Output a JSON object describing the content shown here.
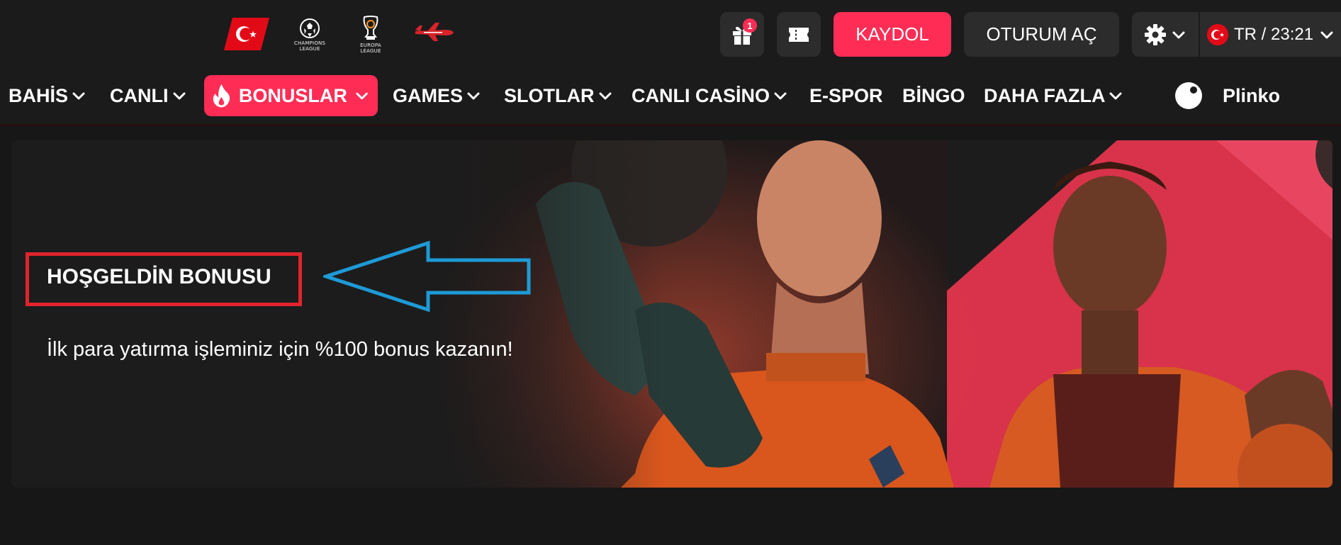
{
  "header": {
    "logos": [
      {
        "name": "turkey-flag-logo",
        "caption": ""
      },
      {
        "name": "champions-league-logo",
        "caption": "CHAMPIONS\nLEAGUE"
      },
      {
        "name": "europa-league-logo",
        "caption": "EUROPA\nLEAGUE"
      },
      {
        "name": "aviator-plane-logo",
        "caption": ""
      }
    ],
    "gift_badge": "1",
    "register_label": "KAYDOL",
    "login_label": "OTURUM AÇ",
    "language_time": "TR / 23:21"
  },
  "nav": {
    "items": [
      {
        "label": "BAHİS",
        "has_dropdown": true
      },
      {
        "label": "CANLI",
        "has_dropdown": true
      },
      {
        "label": "BONUSLAR",
        "has_dropdown": true,
        "active": true
      },
      {
        "label": "GAMES",
        "has_dropdown": true
      },
      {
        "label": "SLOTLAR",
        "has_dropdown": true
      },
      {
        "label": "CANLI CASİNO",
        "has_dropdown": true
      },
      {
        "label": "E-SPOR",
        "has_dropdown": false
      },
      {
        "label": "BİNGO",
        "has_dropdown": false
      },
      {
        "label": "DAHA FAZLA",
        "has_dropdown": true
      },
      {
        "label": "Plinko",
        "has_dropdown": false
      }
    ]
  },
  "banner": {
    "title": "HOŞGELDİN BONUSU",
    "description": "İlk para yatırma işleminiz için %100 bonus kazanın!"
  },
  "colors": {
    "accent": "#ff2d55",
    "background": "#171717",
    "bar": "#1b1b1b",
    "button_dark": "#2c2c2c",
    "annotation_box": "#e0242d",
    "annotation_arrow": "#1e9ad6"
  }
}
